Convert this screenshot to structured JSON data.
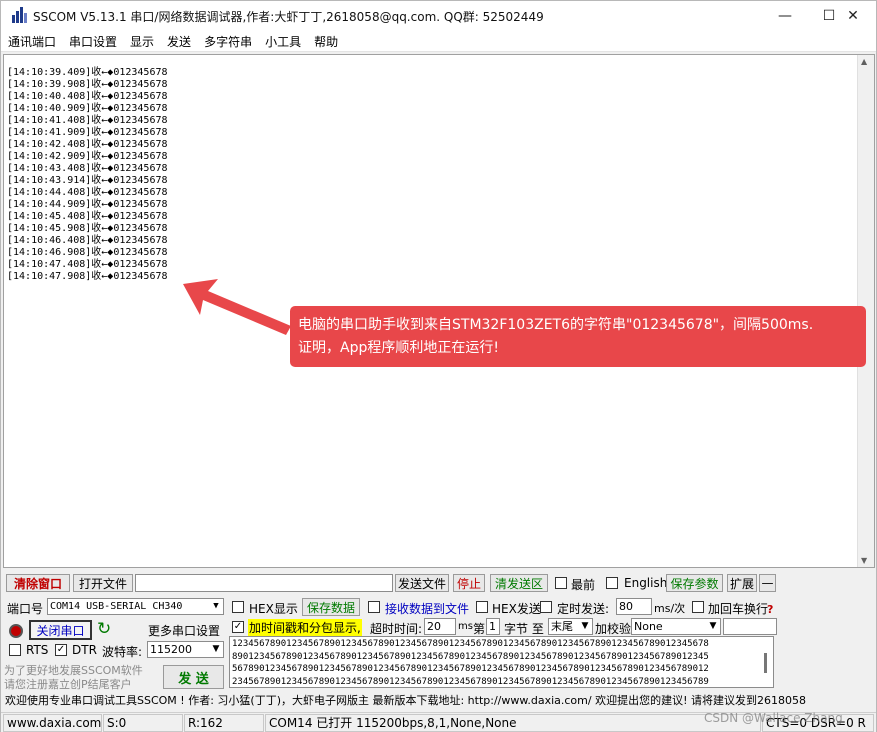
{
  "window": {
    "title": "SSCOM V5.13.1 串口/网络数据调试器,作者:大虾丁丁,2618058@qq.com. QQ群: 52502449",
    "minimize": "—",
    "maximize": "☐",
    "close": "✕"
  },
  "menu": [
    "通讯端口",
    "串口设置",
    "显示",
    "发送",
    "多字符串",
    "小工具",
    "帮助"
  ],
  "receive": {
    "lines": [
      "[14:10:39.409]收←◆012345678",
      "[14:10:39.908]收←◆012345678",
      "[14:10:40.408]收←◆012345678",
      "[14:10:40.909]收←◆012345678",
      "[14:10:41.408]收←◆012345678",
      "[14:10:41.909]收←◆012345678",
      "[14:10:42.408]收←◆012345678",
      "[14:10:42.909]收←◆012345678",
      "[14:10:43.408]收←◆012345678",
      "[14:10:43.914]收←◆012345678",
      "[14:10:44.408]收←◆012345678",
      "[14:10:44.909]收←◆012345678",
      "[14:10:45.408]收←◆012345678",
      "[14:10:45.908]收←◆012345678",
      "[14:10:46.408]收←◆012345678",
      "[14:10:46.908]收←◆012345678",
      "[14:10:47.408]收←◆012345678",
      "[14:10:47.908]收←◆012345678"
    ]
  },
  "callout": {
    "line1": "电脑的串口助手收到来自STM32F103ZET6的字符串\"012345678\"，间隔500ms.",
    "line2": "证明，App程序顺利地正在运行!"
  },
  "toolbar1": {
    "clear_window": "清除窗口",
    "open_file": "打开文件",
    "send_file": "发送文件",
    "stop": "停止",
    "clear_send": "清发送区",
    "frontmost": "最前",
    "english": "English",
    "save_params": "保存参数",
    "expand": "扩展",
    "collapse": "—"
  },
  "port": {
    "port_label": "端口号",
    "port_value": "COM14 USB-SERIAL CH340",
    "close_port": "关闭串口",
    "more_settings": "更多串口设置",
    "rts": "RTS",
    "dtr": "DTR",
    "baud_label": "波特率:",
    "baud_value": "115200",
    "promo1": "为了更好地发展SSCOM软件",
    "promo2": "请您注册嘉立创P结尾客户",
    "send": "发 送"
  },
  "options": {
    "hex_display": "HEX显示",
    "save_data": "保存数据",
    "recv_to_file": "接收数据到文件",
    "hex_send": "HEX发送",
    "timed_send": "定时发送:",
    "timed_value": "80",
    "timed_unit": "ms/次",
    "add_crlf": "加回车换行",
    "timestamp": "加时间戳和分包显示,",
    "timeout_label": "超时时间:",
    "timeout_value": "20",
    "timeout_unit": "ms",
    "nth_label": "第",
    "nth_value": "1",
    "byte_label": "字节 至",
    "end_value": "末尾",
    "checksum_label": "加校验",
    "checksum_value": "None"
  },
  "send_area": {
    "lines": [
      "1234567890123456789012345678901234567890123456789012345678901234567890123456789012345678",
      "8901234567890123456789012345678901234567890123456789012345678901234567890123456789012345",
      "5678901234567890123456789012345678901234567890123456789012345678901234567890123456789012",
      "2345678901234567890123456789012345678901234567890123456789012345678901234567890123456789"
    ]
  },
  "infobar": {
    "text": "欢迎使用专业串口调试工具SSCOM !  作者: 习小猛(丁丁)，大虾电子网版主  最新版本下载地址: http://www.daxia.com/  欢迎提出您的建议! 请将建议发到2618058"
  },
  "status": {
    "website": "www.daxia.com",
    "sent": "S:0",
    "received": "R:162",
    "port_state": "COM14 已打开  115200bps,8,1,None,None",
    "lines": "CTS=0 DSR=0 R",
    "watermark": "CSDN @Wallace Zhang"
  },
  "colors": {
    "callout": "#e8474a",
    "timestamp_highlight": "#ffff00",
    "accent_red": "#c00000",
    "accent_green": "#007a00",
    "accent_blue": "#0000c0"
  }
}
